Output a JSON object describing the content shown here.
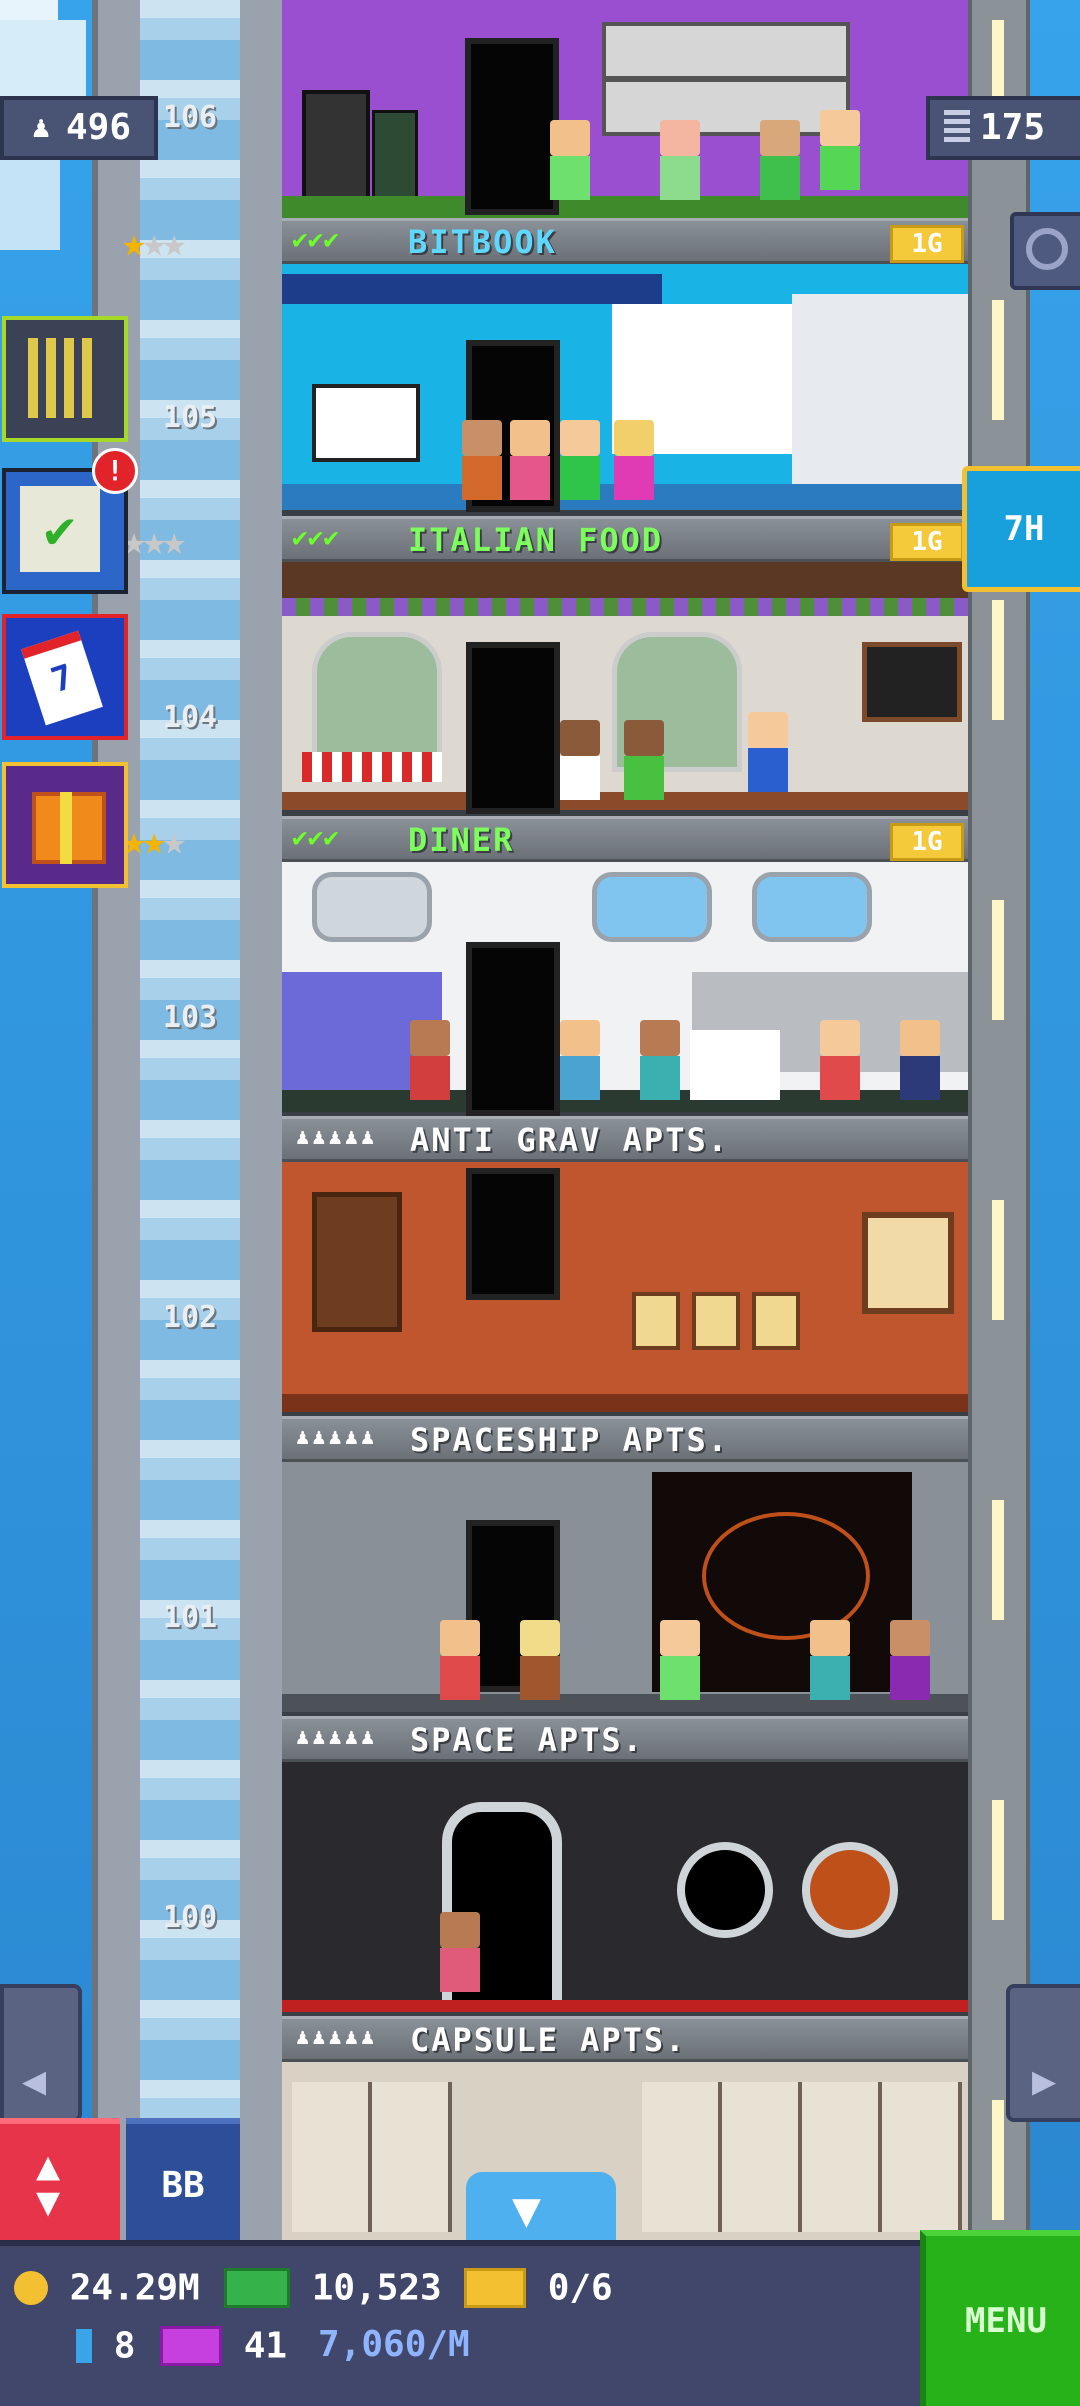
{
  "hud": {
    "population": "496",
    "floors_count": "175",
    "bux_timer": "7H"
  },
  "floors": [
    {
      "number": "106",
      "name": "BITBOOK",
      "tag": "1G"
    },
    {
      "number": "105",
      "name": "ITALIAN FOOD",
      "tag": "1G"
    },
    {
      "number": "104",
      "name": "DINER",
      "tag": "1G"
    },
    {
      "number": "103",
      "name": "ANTI GRAV APTS."
    },
    {
      "number": "102",
      "name": "SPACESHIP APTS."
    },
    {
      "number": "101",
      "name": "SPACE APTS."
    },
    {
      "number": "100",
      "name": "CAPSULE APTS."
    }
  ],
  "elevator": {
    "label": "BB"
  },
  "bottom_bar": {
    "coins": "24.29M",
    "bux": "10,523",
    "vip": "0/6",
    "elevator_count": "8",
    "tickets": "41",
    "rate": "7,060/M",
    "menu_label": "MENU"
  },
  "colors": {
    "menu_green": "#28b21a",
    "elevator_red": "#e8344a",
    "bux_tag_gold": "#f4c93a",
    "check_green": "#6cff2a"
  },
  "icons": [
    "person-icon",
    "floors-icon",
    "search-icon",
    "building-icon",
    "checklist-icon",
    "calendar-icon",
    "gift-icon",
    "up-down-icon",
    "down-arrow-icon",
    "left-arrow-icon",
    "right-arrow-icon",
    "coin-icon",
    "bux-icon",
    "vip-icon",
    "ticket-icon",
    "elevator-icon"
  ]
}
